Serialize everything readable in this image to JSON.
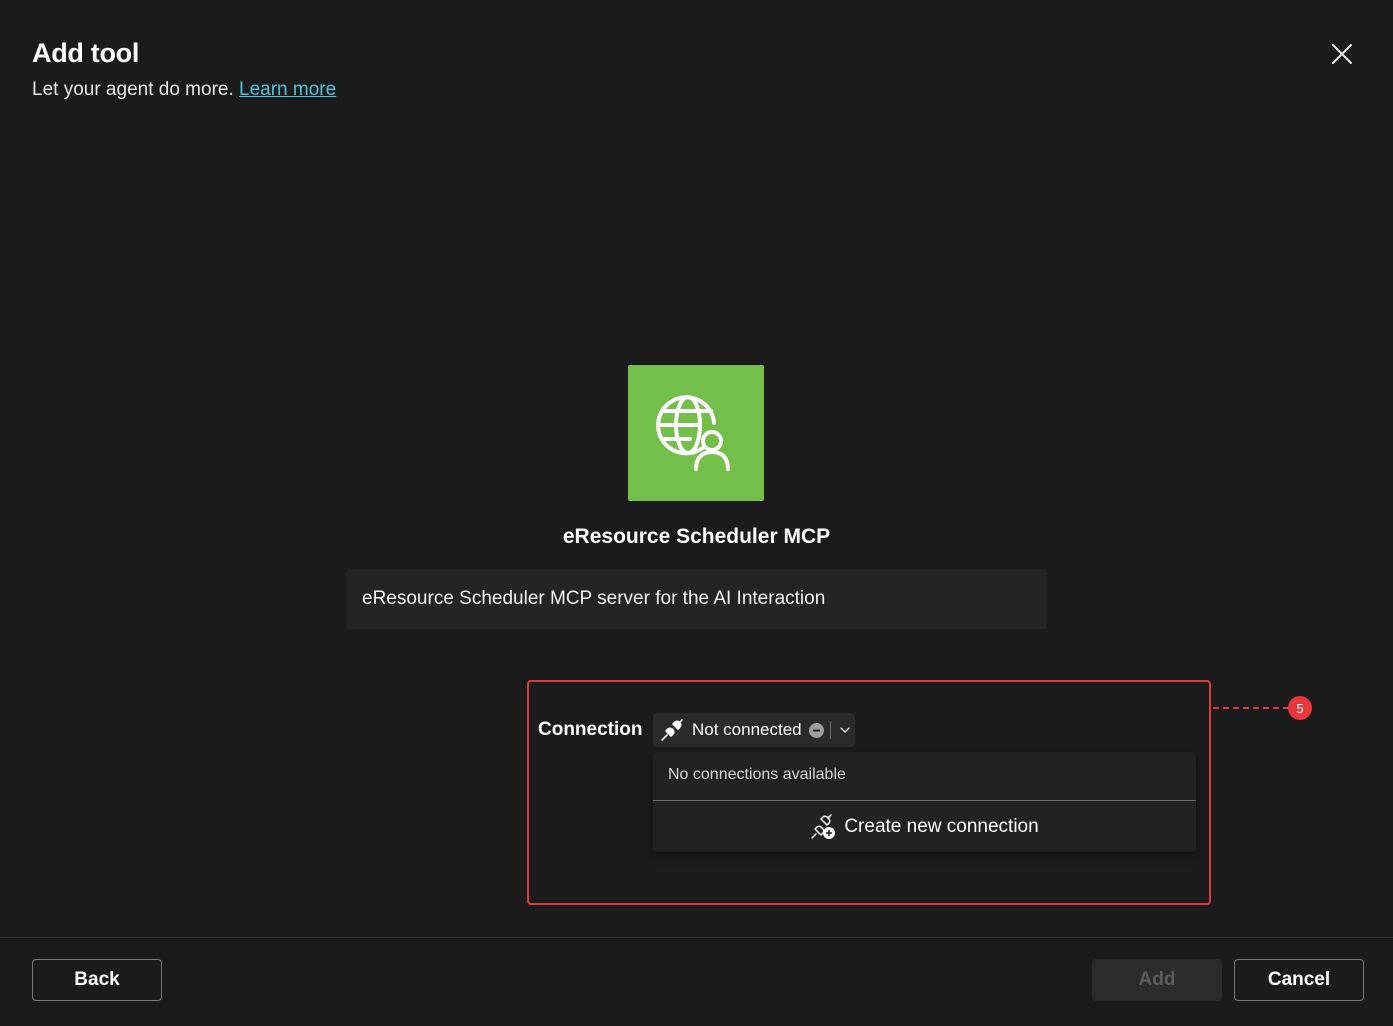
{
  "header": {
    "title": "Add tool",
    "subtitle": "Let your agent do more.",
    "learn_more": "Learn more"
  },
  "tool": {
    "icon": "globe-person-icon",
    "icon_bg": "#74bf4b",
    "name": "eResource Scheduler MCP",
    "description": "eResource Scheduler MCP server for the AI Interaction"
  },
  "connection": {
    "label": "Connection",
    "status": "Not connected",
    "empty_message": "No connections available",
    "create_label": "Create new connection"
  },
  "annotation": {
    "badge": "5",
    "color": "#e0393e"
  },
  "footer": {
    "back": "Back",
    "add": "Add",
    "cancel": "Cancel"
  }
}
